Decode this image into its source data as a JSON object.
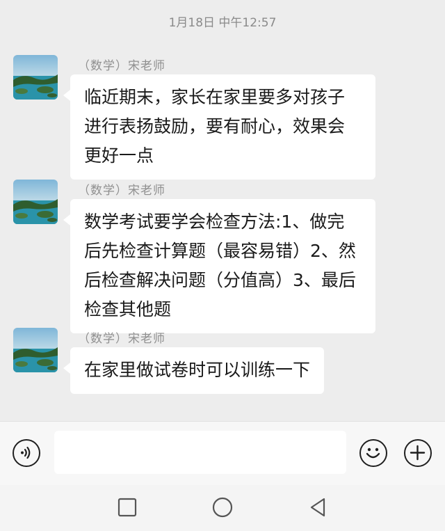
{
  "chat": {
    "timestamp": "1月18日 中午12:57",
    "messages": [
      {
        "sender": "（数学）宋老师",
        "text": "临近期末，家长在家里要多对孩子进行表扬鼓励，要有耐心，效果会更好一点"
      },
      {
        "sender": "（数学）宋老师",
        "text": "数学考试要学会检查方法:1、做完后先检查计算题（最容易错）2、然后检查解决问题（分值高）3、最后检查其他题"
      },
      {
        "sender": "（数学）宋老师",
        "text": "在家里做试卷时可以训练一下"
      }
    ]
  },
  "inputbar": {
    "voice_icon": "voice-icon",
    "emoji_icon": "emoji-icon",
    "plus_icon": "plus-icon",
    "message_value": ""
  },
  "navbar": {
    "icons": [
      "square-recents-icon",
      "circle-home-icon",
      "triangle-back-icon"
    ]
  },
  "colors": {
    "background": "#ededed",
    "bubble": "#ffffff",
    "meta_text": "#8a8a8a"
  }
}
